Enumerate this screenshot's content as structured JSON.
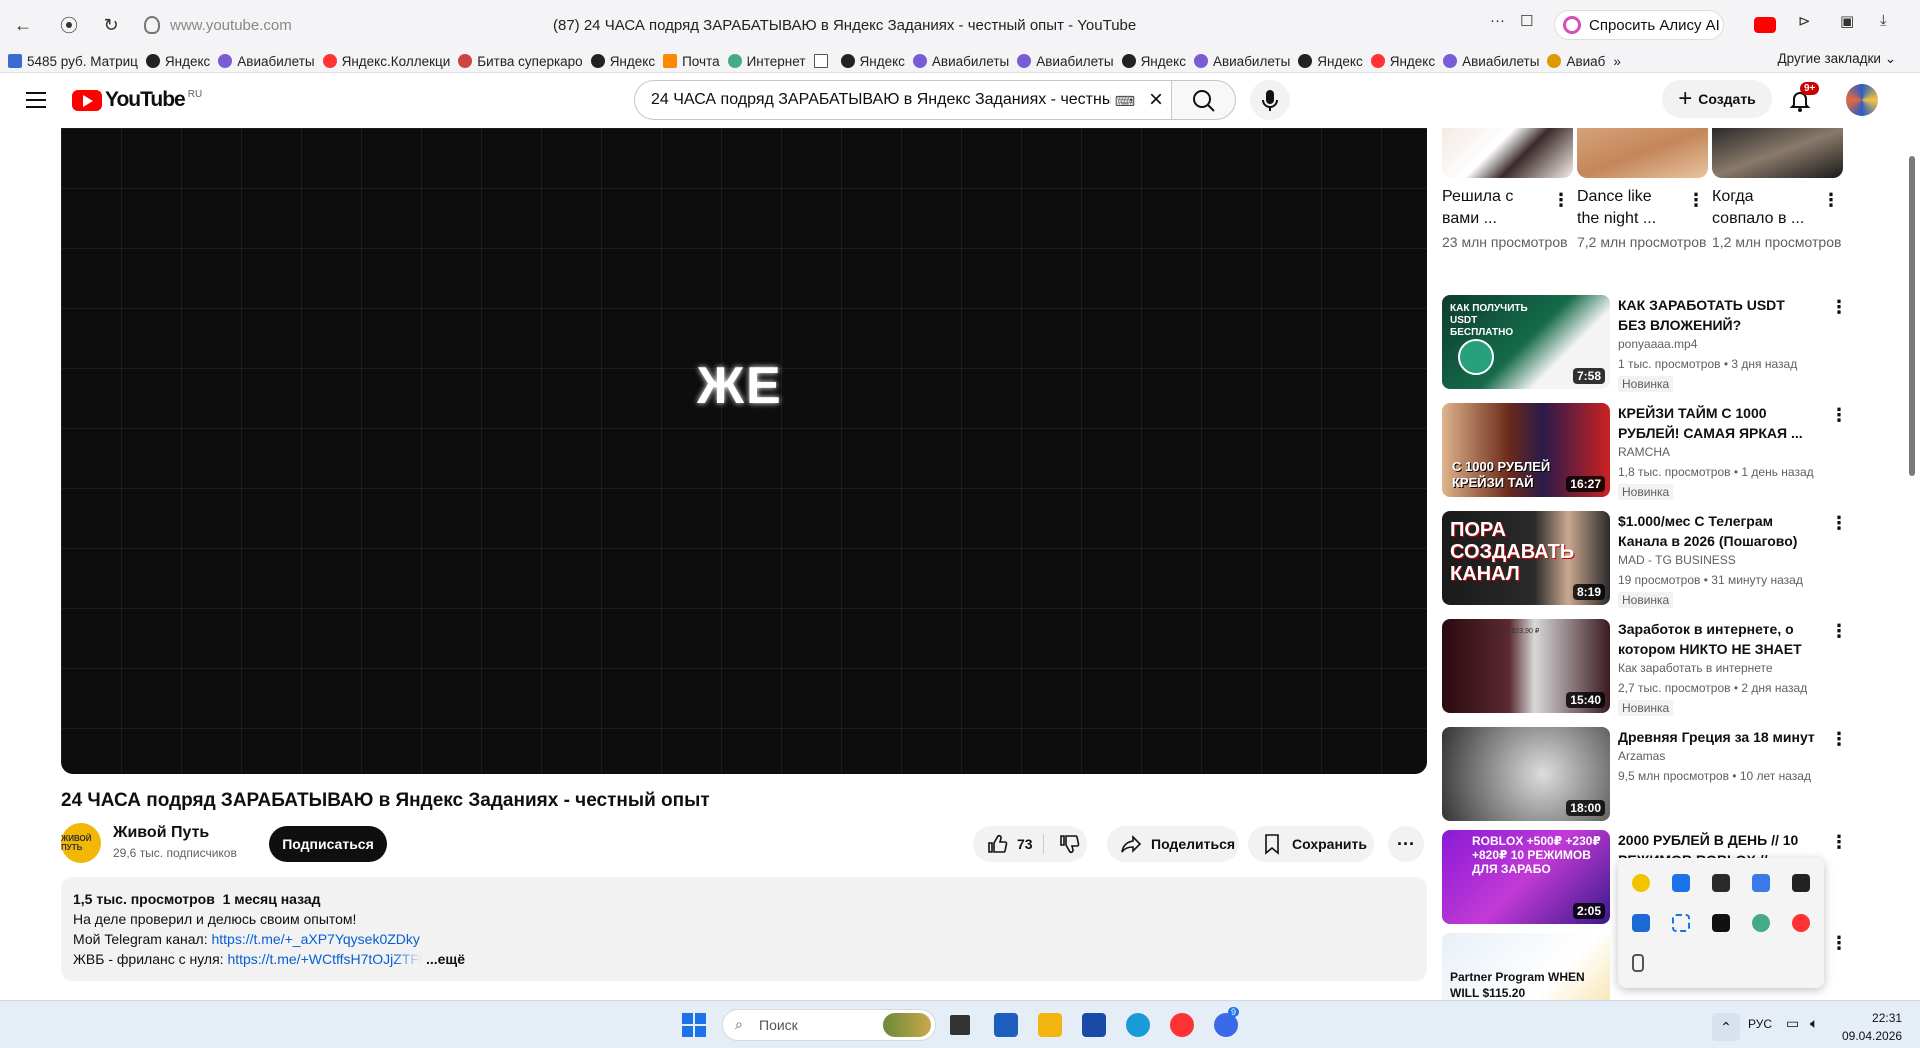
{
  "browser": {
    "url": "www.youtube.com",
    "tab_title": "(87) 24 ЧАСА подряд ЗАРАБАТЫВАЮ в Яндекс Заданиях - честный опыт - YouTube",
    "alice_label": "Спросить Алису AI",
    "bookmarks": [
      "5485 руб. Матриц",
      "Яндекс",
      "Авиабилеты",
      "Яндекс.Коллекци",
      "Битва суперкаро",
      "Яндекс",
      "Почта",
      "Интернет",
      "",
      "Яндекс",
      "Авиабилеты",
      "Авиабилеты",
      "Яндекс",
      "Авиабилеты",
      "Яндекс",
      "Яндекс",
      "Авиабилеты",
      "Авиаб"
    ],
    "other_bookmarks": "Другие закладки"
  },
  "youtube": {
    "logo_word": "YouTube",
    "region": "RU",
    "search_value": "24 ЧАСА подряд ЗАРАБАТЫВАЮ в Яндекс Заданиях - честный опыт",
    "create_label": "Создать",
    "notifications_badge": "9+"
  },
  "player": {
    "frame_text": "ЖЕ"
  },
  "video": {
    "title": "24 ЧАСА подряд ЗАРАБАТЫВАЮ в Яндекс Заданиях - честный опыт",
    "channel": "Живой Путь",
    "subscribers": "29,6 тыс. подписчиков",
    "subscribe_label": "Подписаться",
    "likes": "73",
    "share_label": "Поделиться",
    "save_label": "Сохранить",
    "avatar_text": "ЖИВОЙ ПУТЬ",
    "description": {
      "views": "1,5 тыс. просмотров",
      "date": "1 месяц назад",
      "line1": "На деле проверил и делюсь своим опытом!",
      "line2_label": "Мой Telegram канал: ",
      "line2_link": "https://t.me/+_aXP7Yqysek0ZDky",
      "line3_label": "ЖВБ - фриланс с нуля: ",
      "line3_link": "https://t.me/+WCtffsH7tOJjZTFl",
      "more": "...ещё"
    }
  },
  "shorts": [
    {
      "title": "Решила с вами ...",
      "views": "23 млн просмотров"
    },
    {
      "title": "Dance like the night ...",
      "views": "7,2 млн просмотров"
    },
    {
      "title": "Когда совпало в ...",
      "views": "1,2 млн просмотров"
    }
  ],
  "recommendations": [
    {
      "title": "КАК ЗАРАБОТАТЬ USDT БЕЗ ВЛОЖЕНИЙ?",
      "channel": "ponyaaaa.mp4",
      "meta": "1 тыс. просмотров • 3 дня назад",
      "badge": "Новинка",
      "duration": "7:58",
      "thumb_text": "КАК ПОЛУЧИТЬ USDT БЕСПЛАТНО"
    },
    {
      "title": "КРЕЙЗИ ТАЙМ С 1000 РУБЛЕЙ! САМАЯ ЯРКАЯ ...",
      "channel": "RAMCHA",
      "meta": "1,8 тыс. просмотров • 1 день назад",
      "badge": "Новинка",
      "duration": "16:27",
      "thumb_text": "С 1000 РУБЛЕЙ КРЕЙЗИ ТАЙ"
    },
    {
      "title": "$1.000/мес С Телеграм Канала в 2026 (Пошагово)",
      "channel": "MAD - TG BUSINESS",
      "meta": "19 просмотров • 31 минуту назад",
      "badge": "Новинка",
      "duration": "8:19",
      "thumb_text": "ПОРА СОЗДАВАТЬ КАНАЛ"
    },
    {
      "title": "Заработок в интернете, о котором НИКТО НЕ ЗНАЕТ",
      "channel": "Как заработать в интернете",
      "meta": "2,7 тыс. просмотров • 2 дня назад",
      "badge": "Новинка",
      "duration": "15:40",
      "thumb_text": "2 272 623,90 ₽"
    },
    {
      "title": "Древняя Греция за 18 минут",
      "channel": "Arzamas",
      "meta": "9,5 млн просмотров • 10 лет назад",
      "badge": "",
      "duration": "18:00",
      "thumb_text": ""
    },
    {
      "title": "2000 РУБЛЕЙ В ДЕНЬ // 10 РЕЖИМОВ ROBLOX //",
      "channel": "",
      "meta": "",
      "badge": "",
      "duration": "2:05",
      "thumb_text": "ROBLOX +500₽ +230₽ +820₽ 10 РЕЖИМОВ ДЛЯ ЗАРАБО"
    },
    {
      "title": "",
      "channel": "",
      "meta": "",
      "badge": "",
      "duration": "",
      "thumb_text": "Partner Program WHEN WILL $115.20"
    }
  ],
  "taskbar": {
    "search_placeholder": "Поиск",
    "language": "РУС",
    "time": "22:31",
    "date": "09.04.2026",
    "app_badge": "9"
  },
  "colors": {
    "youtube_red": "#ff0000",
    "link": "#065fd4",
    "accent_blue": "#1a73e8"
  }
}
